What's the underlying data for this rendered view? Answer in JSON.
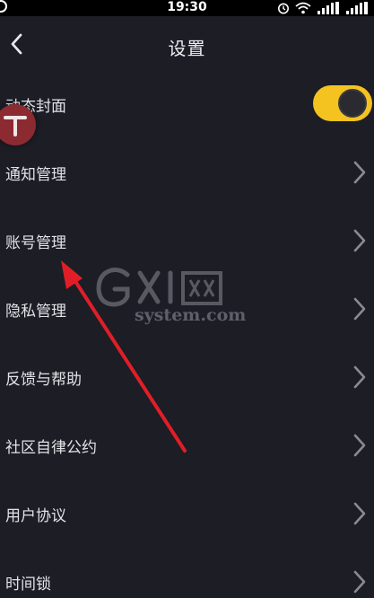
{
  "status_bar": {
    "time": "19:30"
  },
  "header": {
    "title": "设置",
    "back_icon": "chevron-left-icon"
  },
  "settings": {
    "items": [
      {
        "label": "动态封面",
        "control": "toggle",
        "toggle_on": true
      },
      {
        "label": "通知管理",
        "control": "chevron"
      },
      {
        "label": "账号管理",
        "control": "chevron"
      },
      {
        "label": "隐私管理",
        "control": "chevron"
      },
      {
        "label": "反馈与帮助",
        "control": "chevron"
      },
      {
        "label": "社区自律公约",
        "control": "chevron"
      },
      {
        "label": "用户协议",
        "control": "chevron"
      },
      {
        "label": "时间锁",
        "control": "chevron"
      }
    ]
  },
  "watermark": {
    "text": "system.com"
  },
  "colors": {
    "background": "#1c1d25",
    "toggle_on": "#f5c320",
    "annotation_arrow": "#e01e28",
    "badge": "#8c2a32"
  }
}
